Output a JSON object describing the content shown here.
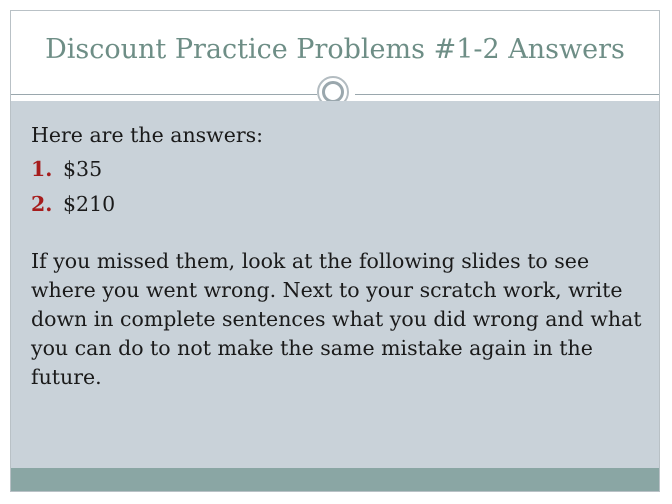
{
  "slide": {
    "title": "Discount Practice Problems #1-2 Answers",
    "intro": "Here are the answers:",
    "answers": [
      {
        "number": "1.",
        "value": "$35"
      },
      {
        "number": "2.",
        "value": "$210"
      }
    ],
    "paragraph": "If you missed them, look at the following slides to see where you went wrong.  Next to your scratch work, write down in complete sentences what you did wrong and what you can do to not make the same mistake again in the future."
  },
  "colors": {
    "title": "#6e8e86",
    "content_background": "#c9d2d9",
    "bottom_bar": "#8aa6a4",
    "list_number": "#a61c1c"
  }
}
